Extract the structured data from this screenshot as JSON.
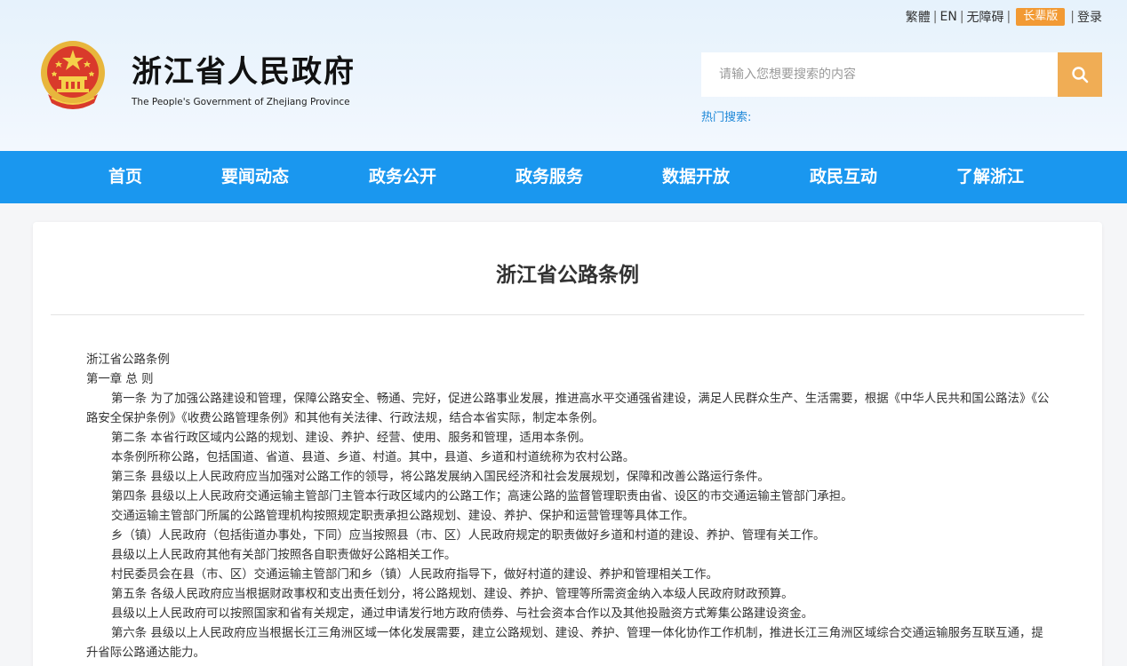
{
  "topbar": {
    "traditional": "繁體",
    "english": "EN",
    "accessibility": "无障碍",
    "elder": "长辈版",
    "login": "登录"
  },
  "site": {
    "title": "浙江省人民政府",
    "subtitle": "The People's Government of Zhejiang Province"
  },
  "search": {
    "placeholder": "请输入您想要搜索的内容",
    "hot_label": "热门搜索:"
  },
  "nav": [
    "首页",
    "要闻动态",
    "政务公开",
    "政务服务",
    "数据开放",
    "政民互动",
    "了解浙江"
  ],
  "article": {
    "title": "浙江省公路条例",
    "paragraphs": [
      "浙江省公路条例",
      "第一章 总 则",
      "第一条 为了加强公路建设和管理，保障公路安全、畅通、完好，促进公路事业发展，推进高水平交通强省建设，满足人民群众生产、生活需要，根据《中华人民共和国公路法》《公路安全保护条例》《收费公路管理条例》和其他有关法律、行政法规，结合本省实际，制定本条例。",
      "第二条 本省行政区域内公路的规划、建设、养护、经营、使用、服务和管理，适用本条例。",
      "本条例所称公路，包括国道、省道、县道、乡道、村道。其中，县道、乡道和村道统称为农村公路。",
      "第三条 县级以上人民政府应当加强对公路工作的领导，将公路发展纳入国民经济和社会发展规划，保障和改善公路运行条件。",
      "第四条 县级以上人民政府交通运输主管部门主管本行政区域内的公路工作；高速公路的监督管理职责由省、设区的市交通运输主管部门承担。",
      "交通运输主管部门所属的公路管理机构按照规定职责承担公路规划、建设、养护、保护和运营管理等具体工作。",
      "乡（镇）人民政府（包括街道办事处，下同）应当按照县（市、区）人民政府规定的职责做好乡道和村道的建设、养护、管理有关工作。",
      "县级以上人民政府其他有关部门按照各自职责做好公路相关工作。",
      "村民委员会在县（市、区）交通运输主管部门和乡（镇）人民政府指导下，做好村道的建设、养护和管理相关工作。",
      "第五条 各级人民政府应当根据财政事权和支出责任划分，将公路规划、建设、养护、管理等所需资金纳入本级人民政府财政预算。",
      "县级以上人民政府可以按照国家和省有关规定，通过申请发行地方政府债券、与社会资本合作以及其他投融资方式筹集公路建设资金。",
      "第六条 县级以上人民政府应当根据长江三角洲区域一体化发展需要，建立公路规划、建设、养护、管理一体化协作工作机制，推进长江三角洲区域综合交通运输服务互联互通，提升省际公路通达能力。"
    ]
  },
  "colors": {
    "nav_bg": "#1a97ef",
    "search_btn": "#f0ad55",
    "elder_badge": "#f29a34",
    "hot_label": "#1e88d8"
  }
}
